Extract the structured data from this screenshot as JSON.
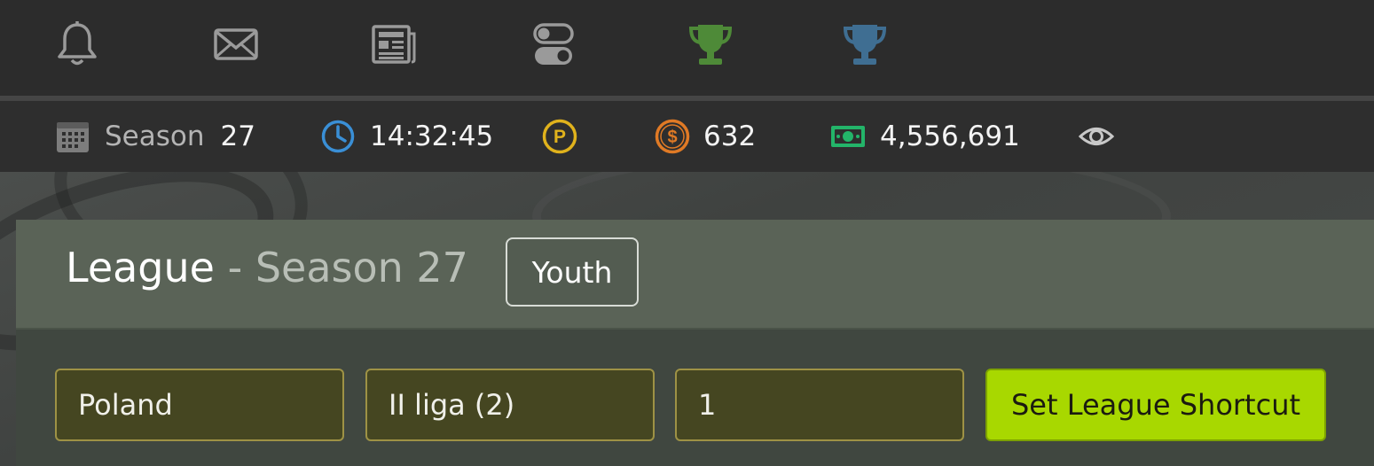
{
  "topbar": {
    "icons": [
      "bell-icon",
      "mail-icon",
      "newspaper-icon",
      "toggles-icon",
      "trophy-green-icon",
      "trophy-blue-icon"
    ],
    "colors": {
      "default": "#9a9a9a",
      "trophy_green": "#4e8a38",
      "trophy_blue": "#3f6e92"
    }
  },
  "status": {
    "season_label": "Season",
    "season_value": "27",
    "time": "14:32:45",
    "premium_symbol": "P",
    "coins_symbol": "$",
    "coins": "632",
    "money": "4,556,691",
    "colors": {
      "clock": "#3a8fd6",
      "premium": "#e0b21c",
      "coins": "#e07a25",
      "money": "#23b469"
    }
  },
  "league": {
    "title": "League",
    "separator": " - ",
    "season": "Season 27",
    "youth_label": "Youth",
    "country_value": "Poland",
    "division_value": "II liga (2)",
    "group_value": "1",
    "shortcut_label": "Set League Shortcut"
  }
}
